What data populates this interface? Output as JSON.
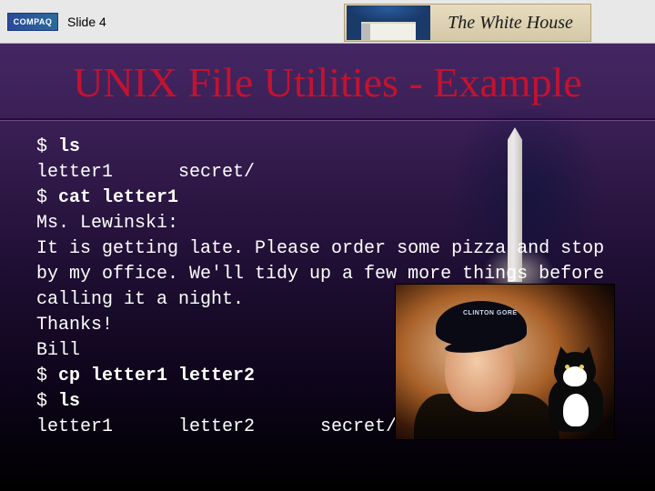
{
  "header": {
    "logo_text": "COMPAQ",
    "slide_label": "Slide 4",
    "banner_text": "The White House"
  },
  "title": "UNIX File Utilities - Example",
  "terminal": {
    "lines": [
      {
        "text": "$ ",
        "bold": false
      },
      {
        "text": "ls",
        "bold": true,
        "br": true
      },
      {
        "text": "letter1      secret/",
        "bold": false,
        "br": true
      },
      {
        "text": "$ ",
        "bold": false
      },
      {
        "text": "cat letter1",
        "bold": true,
        "br": true
      },
      {
        "text": "Ms. Lewinski:",
        "bold": false,
        "br": true
      },
      {
        "text": "It is getting late. Please order some pizza and stop",
        "bold": false,
        "br": true
      },
      {
        "text": "by my office. We'll tidy up a few more things before",
        "bold": false,
        "br": true
      },
      {
        "text": "calling it a night.",
        "bold": false,
        "br": true
      },
      {
        "text": "Thanks!",
        "bold": false,
        "br": true
      },
      {
        "text": "Bill",
        "bold": false,
        "br": true
      },
      {
        "text": "$ ",
        "bold": false
      },
      {
        "text": "cp letter1 letter2",
        "bold": true,
        "br": true
      },
      {
        "text": "$ ",
        "bold": false
      },
      {
        "text": "ls",
        "bold": true,
        "br": true
      },
      {
        "text": "letter1      letter2      secret/",
        "bold": false,
        "br": true
      }
    ]
  },
  "photo": {
    "cap_text": "CLINTON\nGORE"
  }
}
